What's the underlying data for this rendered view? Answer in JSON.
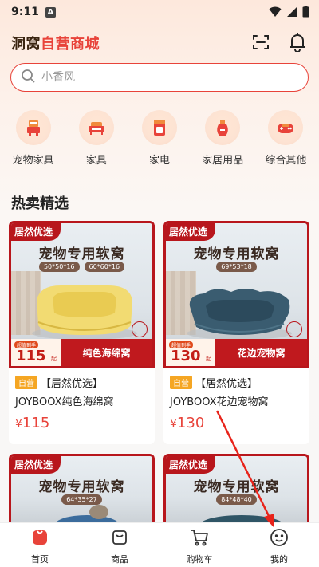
{
  "status_bar": {
    "time": "9:11",
    "a_badge": "A"
  },
  "header": {
    "title_part1": "洞窝",
    "title_part2": "自营商城"
  },
  "search": {
    "placeholder": "小香风"
  },
  "categories": [
    {
      "label": "宠物家具",
      "icon": "pet-furniture-icon"
    },
    {
      "label": "家具",
      "icon": "sofa-icon"
    },
    {
      "label": "家电",
      "icon": "appliance-icon"
    },
    {
      "label": "家居用品",
      "icon": "vase-icon"
    },
    {
      "label": "综合其他",
      "icon": "gamepad-icon"
    }
  ],
  "section": {
    "title": "热卖精选"
  },
  "products": [
    {
      "badge": "居然优选",
      "img_title": "宠物专用软窝",
      "sizes": [
        "50*50*16",
        "60*60*16"
      ],
      "price_tag_label": "超值到手",
      "price_tag_value": "115",
      "price_tag_unit": "起",
      "strip_name": "纯色海绵窝",
      "self_op": "自营",
      "title_line1": "【居然优选】",
      "title_line2": "JOYBOOX纯色海绵窝",
      "yen": "¥",
      "price": "115"
    },
    {
      "badge": "居然优选",
      "img_title": "宠物专用软窝",
      "sizes": [
        "69*53*18"
      ],
      "price_tag_label": "超值到手",
      "price_tag_value": "130",
      "price_tag_unit": "起",
      "strip_name": "花边宠物窝",
      "self_op": "自营",
      "title_line1": "【居然优选】",
      "title_line2": "JOYBOOX花边宠物窝",
      "yen": "¥",
      "price": "130"
    },
    {
      "badge": "居然优选",
      "img_title": "宠物专用软窝",
      "sizes": [
        "64*35*27"
      ]
    },
    {
      "badge": "居然优选",
      "img_title": "宠物专用软窝",
      "sizes": [
        "84*48*40"
      ]
    }
  ],
  "tabbar": [
    {
      "label": "首页",
      "icon": "home-icon",
      "active": true
    },
    {
      "label": "商品",
      "icon": "bag-icon"
    },
    {
      "label": "购物车",
      "icon": "cart-icon"
    },
    {
      "label": "我的",
      "icon": "profile-icon"
    }
  ],
  "colors": {
    "accent": "#e8433a",
    "brand_dark_red": "#b8161c",
    "price_red": "#e8433a",
    "self_op_orange": "#f5a623"
  }
}
